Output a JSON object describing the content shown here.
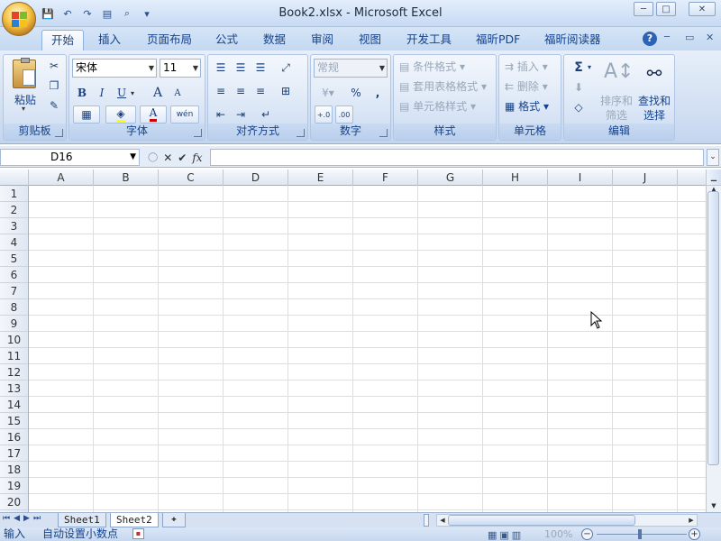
{
  "window": {
    "title": "Book2.xlsx - Microsoft Excel",
    "min": "─",
    "max": "□",
    "close": "✕"
  },
  "qat": {
    "save": "💾",
    "undo": "↶",
    "redo": "↷",
    "customize": "▾"
  },
  "tabs": [
    {
      "label": "开始",
      "active": true
    },
    {
      "label": "插入"
    },
    {
      "label": "页面布局"
    },
    {
      "label": "公式"
    },
    {
      "label": "数据"
    },
    {
      "label": "审阅"
    },
    {
      "label": "视图"
    },
    {
      "label": "开发工具"
    },
    {
      "label": "福昕PDF"
    },
    {
      "label": "福昕阅读器"
    }
  ],
  "ribbon_controls": {
    "help": "?",
    "min": "─",
    "restore": "▭",
    "close": "✕"
  },
  "clipboard": {
    "label": "剪贴板",
    "paste": "粘贴"
  },
  "font": {
    "label": "字体",
    "name": "宋体",
    "size": "11",
    "bold": "B",
    "italic": "I",
    "underline": "U",
    "grow": "A",
    "shrink": "A",
    "wen": "wén",
    "color_accent": "#d40000"
  },
  "alignment": {
    "label": "对齐方式"
  },
  "number": {
    "label": "数字",
    "format": "常规",
    "percent": "%",
    "comma": ",",
    "inc": "+.0",
    "dec": ".00"
  },
  "styles": {
    "label": "样式",
    "conditional": "条件格式",
    "table": "套用表格格式",
    "cell": "单元格样式"
  },
  "cells": {
    "label": "单元格",
    "insert": "插入",
    "delete": "删除",
    "format": "格式"
  },
  "editing": {
    "label": "编辑",
    "sum": "Σ",
    "sort": "排序和",
    "sort2": "筛选",
    "find": "查找和",
    "find2": "选择"
  },
  "formula_bar": {
    "name_box": "D16",
    "fx": "fx",
    "cancel": "✕",
    "enter": "✔",
    "value": ""
  },
  "columns": [
    "A",
    "B",
    "C",
    "D",
    "E",
    "F",
    "G",
    "H",
    "I",
    "J"
  ],
  "rows": [
    "1",
    "2",
    "3",
    "4",
    "5",
    "6",
    "7",
    "8",
    "9",
    "10",
    "11",
    "12",
    "13",
    "14",
    "15",
    "16",
    "17",
    "18",
    "19",
    "20"
  ],
  "sheets": [
    {
      "label": "Sheet1"
    },
    {
      "label": "Sheet2",
      "active": true
    }
  ],
  "status": {
    "mode": "输入",
    "info": "自动设置小数点",
    "zoom": "100%"
  }
}
